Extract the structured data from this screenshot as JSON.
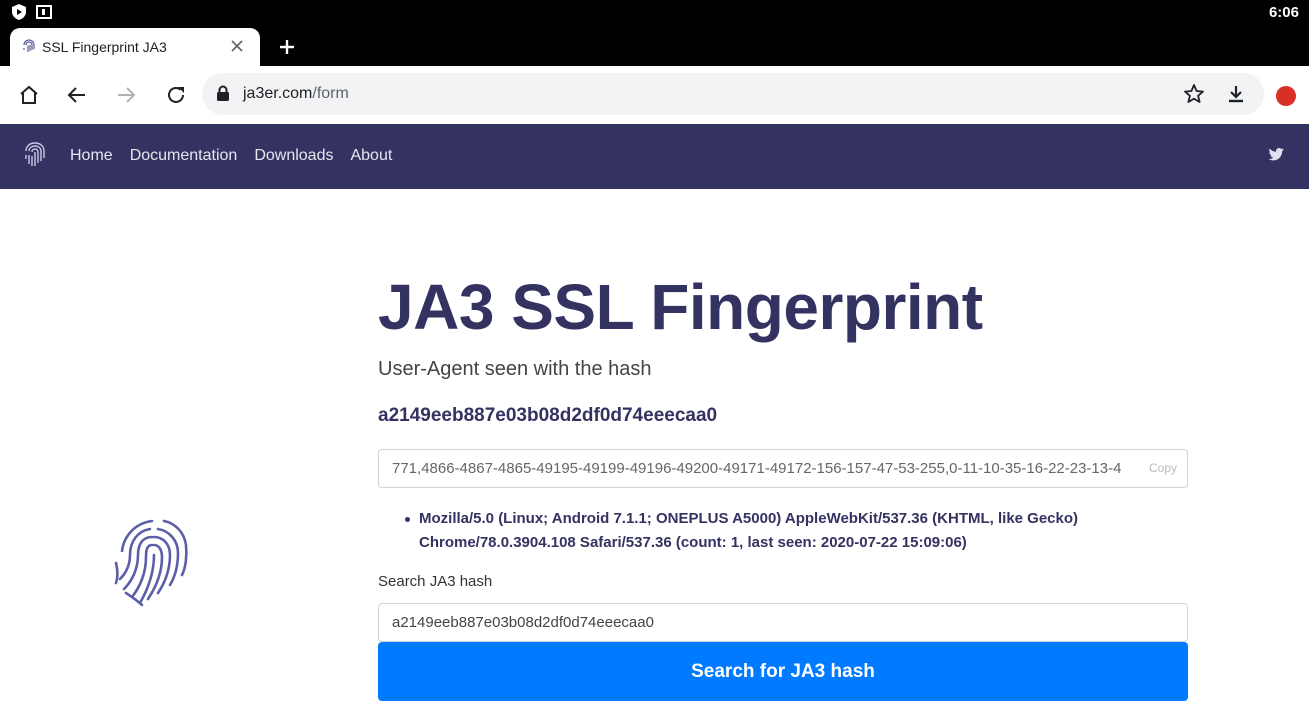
{
  "status": {
    "time": "6:06"
  },
  "tab": {
    "title": "SSL Fingerprint JA3"
  },
  "toolbar": {
    "url_domain": "ja3er.com",
    "url_path": "/form"
  },
  "nav": {
    "links": [
      "Home",
      "Documentation",
      "Downloads",
      "About"
    ]
  },
  "main": {
    "title": "JA3 SSL Fingerprint",
    "subtitle": "User-Agent seen with the hash",
    "hash": "a2149eeb887e03b08d2df0d74eeecaa0",
    "fingerprint_string": "771,4866-4867-4865-49195-49199-49196-49200-49171-49172-156-157-47-53-255,0-11-10-35-16-22-23-13-4",
    "copy_label": "Copy",
    "user_agents": [
      "Mozilla/5.0 (Linux; Android 7.1.1; ONEPLUS A5000) AppleWebKit/537.36 (KHTML, like Gecko) Chrome/78.0.3904.108 Safari/537.36 (count: 1, last seen: 2020-07-22 15:09:06)"
    ],
    "search_label": "Search JA3 hash",
    "search_value": "a2149eeb887e03b08d2df0d74eeecaa0",
    "search_button": "Search for JA3 hash"
  },
  "colors": {
    "nav_bg": "#343260",
    "primary": "#007bff",
    "title": "#343260"
  },
  "icons": [
    "shield-icon",
    "sim-icon",
    "close-icon",
    "plus-icon",
    "home-icon",
    "back-icon",
    "forward-icon",
    "reload-icon",
    "lock-icon",
    "star-icon",
    "download-icon",
    "extension-icon",
    "fingerprint-icon",
    "twitter-icon"
  ]
}
